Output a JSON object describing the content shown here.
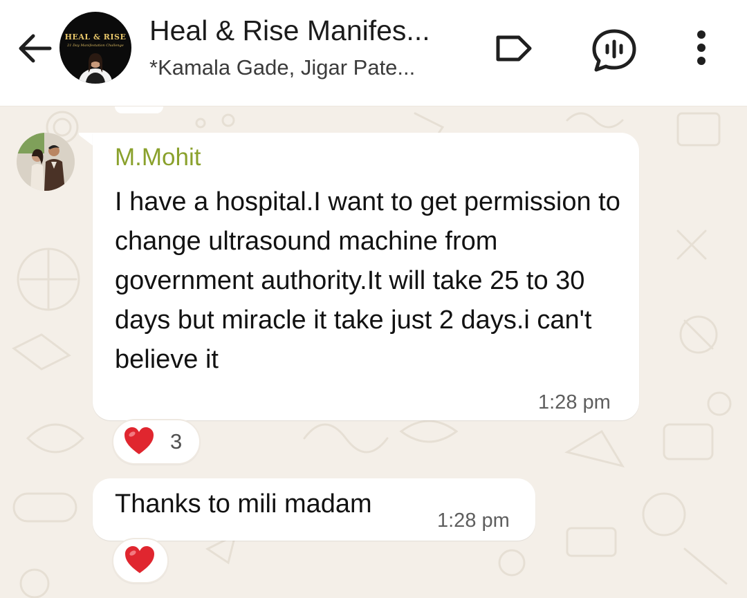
{
  "header": {
    "title": "Heal & Rise Manifes...",
    "subtitle": "*Kamala Gade, Jigar Pate...",
    "avatar_text": "HEAL & RISE",
    "avatar_tagline": "21 Day Manifestation Challenge",
    "icons": {
      "back": "arrow-left-icon",
      "label": "label-tag-icon",
      "voice": "voice-chat-icon",
      "menu": "more-vertical-icon"
    }
  },
  "messages": [
    {
      "sender": "M.Mohit",
      "text": "I have a hospital.I want to get permission to change ultrasound machine from government authority.It will take 25 to 30 days but miracle it take just 2 days.i can't believe it",
      "time": "1:28 pm",
      "reaction": {
        "emoji": "heart",
        "count": "3"
      }
    },
    {
      "text": "Thanks to mili madam",
      "time": "1:28 pm",
      "reaction": {
        "emoji": "heart"
      }
    }
  ],
  "colors": {
    "sender_name": "#8aa12c",
    "wallpaper": "#f4efe8",
    "bubble": "#ffffff",
    "heart": "#e0262f"
  }
}
